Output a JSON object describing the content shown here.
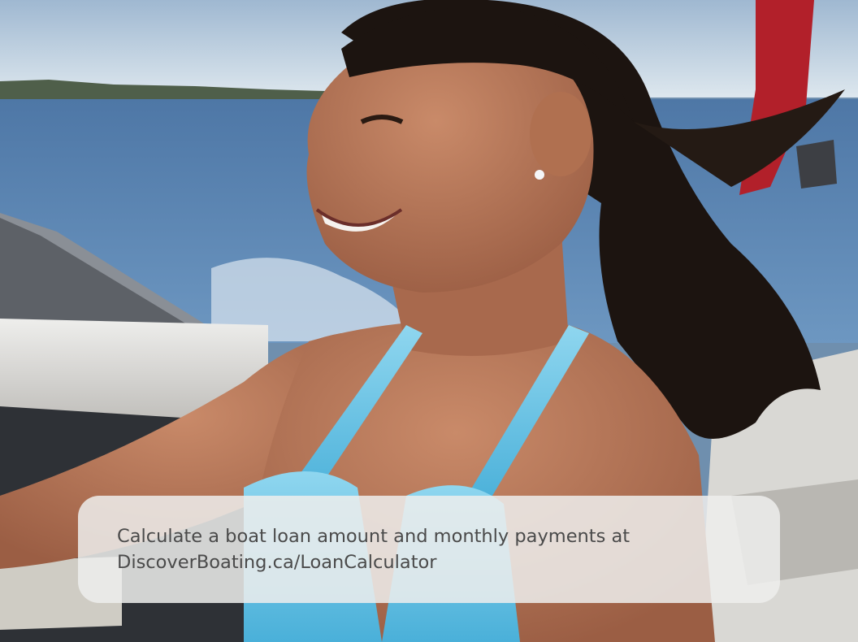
{
  "photo": {
    "subject": "boat-driver-photo",
    "colors": {
      "sky": "#c9d9e6",
      "water": "#5b86b4",
      "boat_deck": "#e2e1de",
      "skin": "#b9785a",
      "hair": "#1c1410",
      "bikini": "#6ec5e6",
      "tower": "#b2202a"
    }
  },
  "caption": {
    "line1": "Calculate a boat loan amount and monthly payments at",
    "line2": "DiscoverBoating.ca/LoanCalculator"
  }
}
